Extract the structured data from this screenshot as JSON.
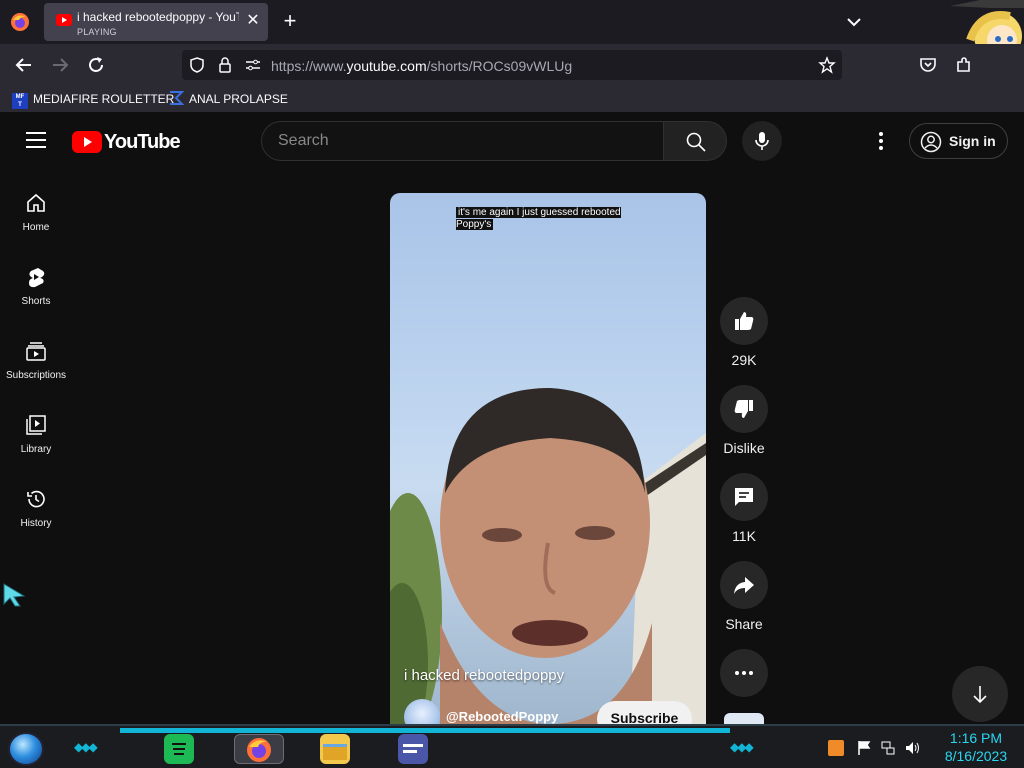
{
  "browser": {
    "tab": {
      "title": "i hacked rebootedpoppy - YouTube",
      "status": "PLAYING"
    },
    "url": {
      "prefix": "https://www.",
      "host": "youtube.com",
      "path": "/shorts/ROCs09vWLUg"
    },
    "bookmarks": [
      {
        "label": "MEDIAFIRE ROULETTER",
        "icon": "mediafire-icon"
      },
      {
        "label": "ANAL PROLAPSE",
        "icon": "bookmark-sigma-icon"
      }
    ]
  },
  "youtube": {
    "logo_text": "YouTube",
    "search": {
      "placeholder": "Search"
    },
    "sign_in_label": "Sign in",
    "sidebar": [
      {
        "label": "Home",
        "icon": "home-icon"
      },
      {
        "label": "Shorts",
        "icon": "shorts-icon"
      },
      {
        "label": "Subscriptions",
        "icon": "subscriptions-icon"
      },
      {
        "label": "Library",
        "icon": "library-icon"
      },
      {
        "label": "History",
        "icon": "history-icon"
      }
    ],
    "short": {
      "caption": "it's me again I just guessed rebooted Poppy's",
      "title": "i hacked rebootedpoppy",
      "channel": "@RebootedPoppy",
      "subscribe_label": "Subscribe"
    },
    "actions": {
      "like": "29K",
      "dislike": "Dislike",
      "comments": "11K",
      "share": "Share"
    }
  },
  "taskbar": {
    "time": "1:16 PM",
    "date": "8/16/2023",
    "accent": "#13b5d6"
  }
}
